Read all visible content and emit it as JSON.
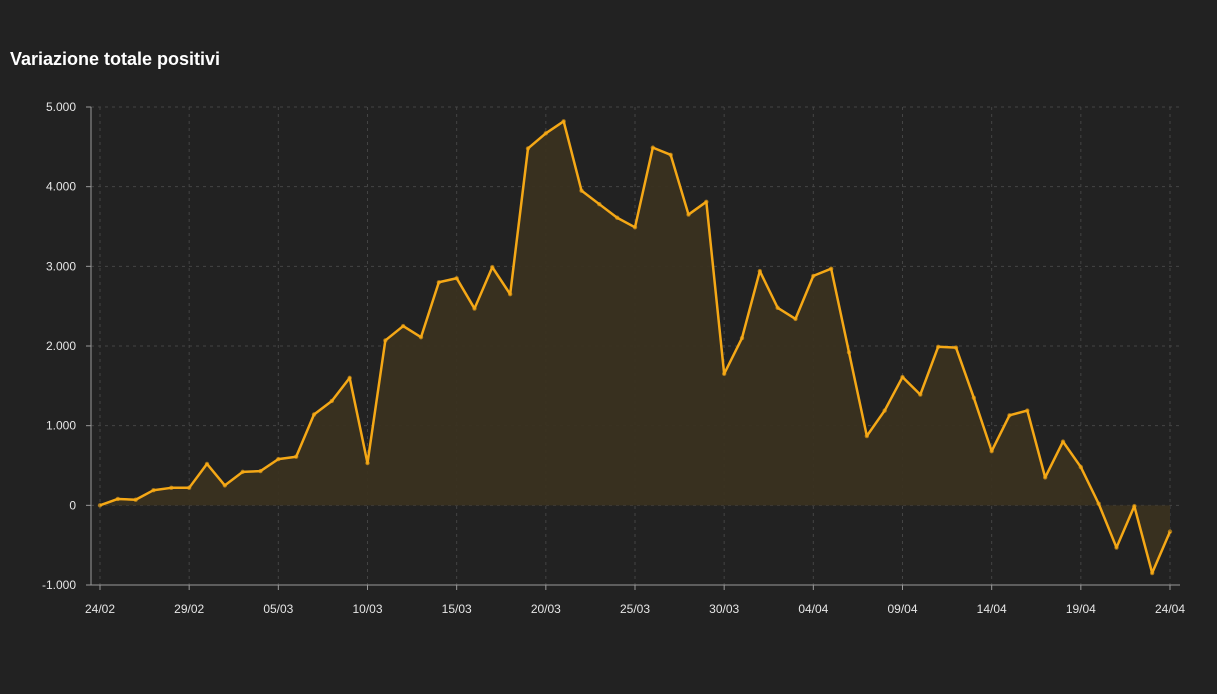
{
  "chart_data": {
    "type": "area",
    "title": "Variazione totale positivi",
    "xlabel": "",
    "ylabel": "",
    "ylim": [
      -1000,
      5000
    ],
    "y_ticks": [
      -1000,
      0,
      1000,
      2000,
      3000,
      4000,
      5000
    ],
    "y_tick_labels": [
      "-1.000",
      "0",
      "1.000",
      "2.000",
      "3.000",
      "4.000",
      "5.000"
    ],
    "x_tick_labels": [
      "24/02",
      "29/02",
      "05/03",
      "10/03",
      "15/03",
      "20/03",
      "25/03",
      "30/03",
      "04/04",
      "09/04",
      "14/04",
      "19/04",
      "24/04"
    ],
    "x_tick_index_step": 5,
    "grid": true,
    "colors": {
      "line": "#f5a816",
      "fill": "#3a3120",
      "grid": "#444444",
      "axis": "#9a9a9a",
      "background": "#222222"
    },
    "x": [
      "24/02",
      "25/02",
      "26/02",
      "27/02",
      "28/02",
      "29/02",
      "01/03",
      "02/03",
      "03/03",
      "04/03",
      "05/03",
      "06/03",
      "07/03",
      "08/03",
      "09/03",
      "10/03",
      "11/03",
      "12/03",
      "13/03",
      "14/03",
      "15/03",
      "16/03",
      "17/03",
      "18/03",
      "19/03",
      "20/03",
      "21/03",
      "22/03",
      "23/03",
      "24/03",
      "25/03",
      "26/03",
      "27/03",
      "28/03",
      "29/03",
      "30/03",
      "31/03",
      "01/04",
      "02/04",
      "03/04",
      "04/04",
      "05/04",
      "06/04",
      "07/04",
      "08/04",
      "09/04",
      "10/04",
      "11/04",
      "12/04",
      "13/04",
      "14/04",
      "15/04",
      "16/04",
      "17/04",
      "18/04",
      "19/04",
      "20/04",
      "21/04",
      "22/04",
      "23/04",
      "24/04"
    ],
    "series": [
      {
        "values": [
          0,
          80,
          70,
          190,
          220,
          220,
          520,
          250,
          420,
          430,
          580,
          610,
          1140,
          1310,
          1600,
          530,
          2070,
          2250,
          2110,
          2800,
          2850,
          2470,
          2990,
          2650,
          4480,
          4670,
          4820,
          3950,
          3780,
          3610,
          3490,
          4490,
          4400,
          3650,
          3810,
          1650,
          2100,
          2940,
          2480,
          2340,
          2880,
          2970,
          1920,
          870,
          1190,
          1610,
          1390,
          1990,
          1980,
          1350,
          680,
          1130,
          1190,
          350,
          800,
          480,
          20,
          -530,
          -10,
          -850,
          -330
        ]
      }
    ]
  }
}
